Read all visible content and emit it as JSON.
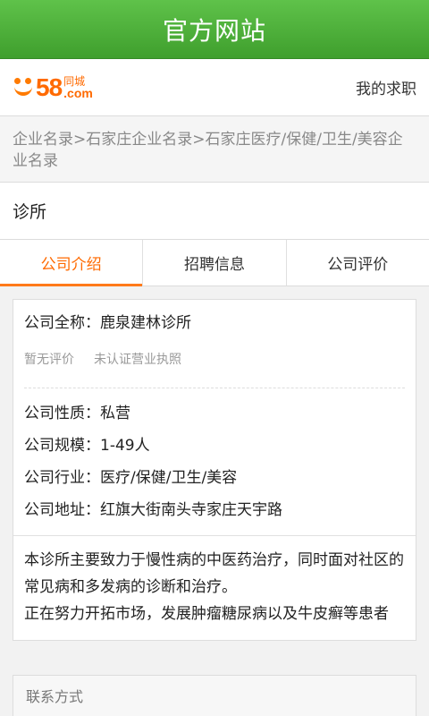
{
  "titlebar": {
    "title": "官方网站"
  },
  "header": {
    "logo_number": "58",
    "logo_cn": "同城",
    "logo_com": ".com",
    "link": "我的求职"
  },
  "breadcrumb": "企业名录>石家庄企业名录>石家庄医疗/保健/卫生/美容企业名录",
  "company": {
    "name": "诊所"
  },
  "tabs": [
    {
      "label": "公司介绍",
      "active": true
    },
    {
      "label": "招聘信息",
      "active": false
    },
    {
      "label": "公司评价",
      "active": false
    }
  ],
  "details": {
    "full_name": "公司全称：鹿泉建林诊所",
    "tags": [
      "暂无评价",
      "未认证营业执照"
    ],
    "nature": "公司性质：私营",
    "size": "公司规模：1-49人",
    "industry": "公司行业：医疗/保健/卫生/美容",
    "address": "公司地址：红旗大街南头寺家庄天宇路",
    "description_1": "本诊所主要致力于慢性病的中医药治疗，同时面对社区的常见病和多发病的诊断和治疗。",
    "description_2": "正在努力开拓市场，发展肿瘤糖尿病以及牛皮癣等患者"
  },
  "contact": {
    "label": "联系方式"
  },
  "colors": {
    "title_green": "#4cae38",
    "accent_orange": "#ff6a00"
  }
}
